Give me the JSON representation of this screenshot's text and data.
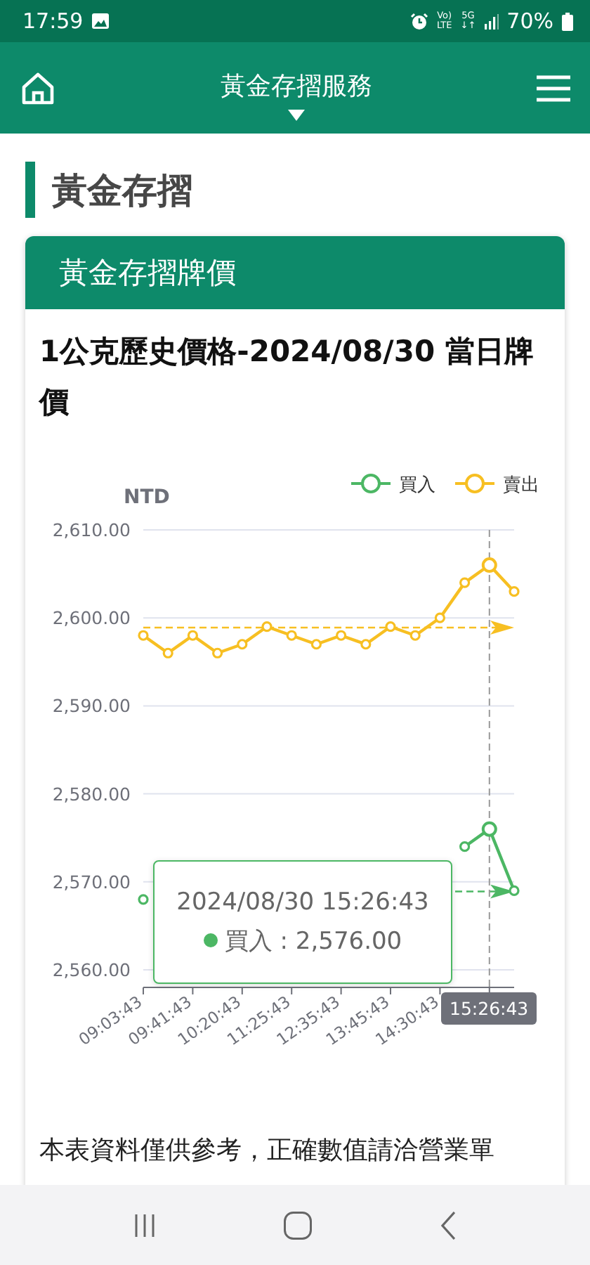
{
  "status_bar": {
    "time": "17:59",
    "volte": {
      "top": "Vo)",
      "bottom": "LTE"
    },
    "network": {
      "top": "5G",
      "bottom": "↓↑"
    },
    "battery": "70%"
  },
  "header": {
    "title": "黃金存摺服務"
  },
  "section_title": "黃金存摺",
  "card": {
    "header": "黃金存摺牌價",
    "title": "1公克歷史價格-2024/08/30 當日牌價",
    "chart_data": {
      "type": "line",
      "ylabel": "NTD",
      "categories": [
        "09:03:43",
        null,
        "09:41:43",
        null,
        "10:20:43",
        null,
        "11:25:43",
        null,
        "12:35:43",
        null,
        "13:45:43",
        null,
        "14:30:43",
        null,
        null,
        null
      ],
      "ylim": [
        2558,
        2610
      ],
      "yticks": [
        {
          "value": 2560,
          "label": "2,560.00"
        },
        {
          "value": 2570,
          "label": "2,570.00"
        },
        {
          "value": 2580,
          "label": "2,580.00"
        },
        {
          "value": 2590,
          "label": "2,590.00"
        },
        {
          "value": 2600,
          "label": "2,600.00"
        },
        {
          "value": 2610,
          "label": "2,610.00"
        }
      ],
      "grid": true,
      "legend": true,
      "series": [
        {
          "name": "買入",
          "color": "#4cb764",
          "marker": "circle",
          "values": [
            2568,
            null,
            null,
            null,
            null,
            null,
            null,
            null,
            null,
            null,
            null,
            null,
            null,
            2574,
            2576,
            2569
          ]
        },
        {
          "name": "賣出",
          "color": "#f7bf22",
          "marker": "circle",
          "values": [
            2598,
            2596,
            2598,
            2596,
            2597,
            2599,
            2598,
            2597,
            2598,
            2597,
            2599,
            2598,
            2600,
            2604,
            2606,
            2603
          ]
        }
      ],
      "ref_lines": [
        {
          "axis": "y",
          "value": 2568.9,
          "color": "#4cb764"
        },
        {
          "axis": "y",
          "value": 2598.9,
          "color": "#f7bf22"
        }
      ]
    },
    "tooltip": {
      "title": "2024/08/30 15:26:43",
      "color": "#4cb764",
      "text": "買入 : 2,576.00"
    },
    "axis_pointer_label": "15:26:43",
    "note": "本表資料僅供參考，正確數值請洽營業單"
  }
}
